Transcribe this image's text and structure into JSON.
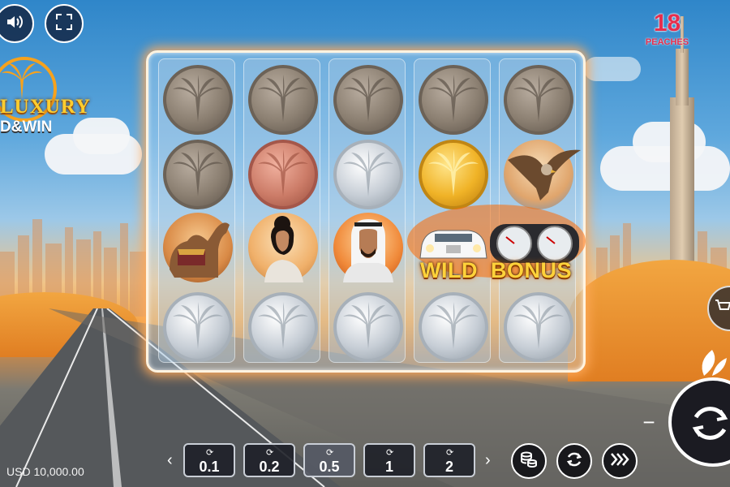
{
  "game": {
    "brand_number": "18",
    "brand_name": "PEACHES",
    "logo_line1": "LUXURY",
    "logo_line2": "D&WIN"
  },
  "controls": {
    "sound_icon": "speaker-icon",
    "fullscreen_icon": "fullscreen-icon",
    "minus_label": "−",
    "buy_icon": "cart-icon",
    "spin_icon": "spin-arrows-icon"
  },
  "reels": [
    {
      "column": 1,
      "symbols": [
        "bronze-coin",
        "bronze-coin",
        "camel",
        "silver-coin"
      ]
    },
    {
      "column": 2,
      "symbols": [
        "bronze-coin",
        "copper-coin",
        "woman",
        "silver-coin"
      ]
    },
    {
      "column": 3,
      "symbols": [
        "bronze-coin",
        "silver-coin",
        "sheikh",
        "silver-coin"
      ]
    },
    {
      "column": 4,
      "symbols": [
        "bronze-coin",
        "gold-coin",
        "wild-car",
        "silver-coin"
      ]
    },
    {
      "column": 5,
      "symbols": [
        "bronze-coin",
        "falcon",
        "bonus-gauges",
        "silver-coin"
      ]
    }
  ],
  "wild_label": "WILD",
  "bonus_label": "BONUS",
  "bets": {
    "options": [
      "0.1",
      "0.2",
      "0.5",
      "1",
      "2"
    ],
    "selected": "0.5"
  },
  "balance_text": "USD 10,000.00",
  "bottom_buttons": [
    "coin-stack-icon",
    "autoplay-icon",
    "turbo-icon"
  ],
  "colors": {
    "frame_glow": "#ffaa5a",
    "wild_text": "#ffd23a",
    "brand": "#e62e4d",
    "logo_gold": "#ffcd2e"
  }
}
